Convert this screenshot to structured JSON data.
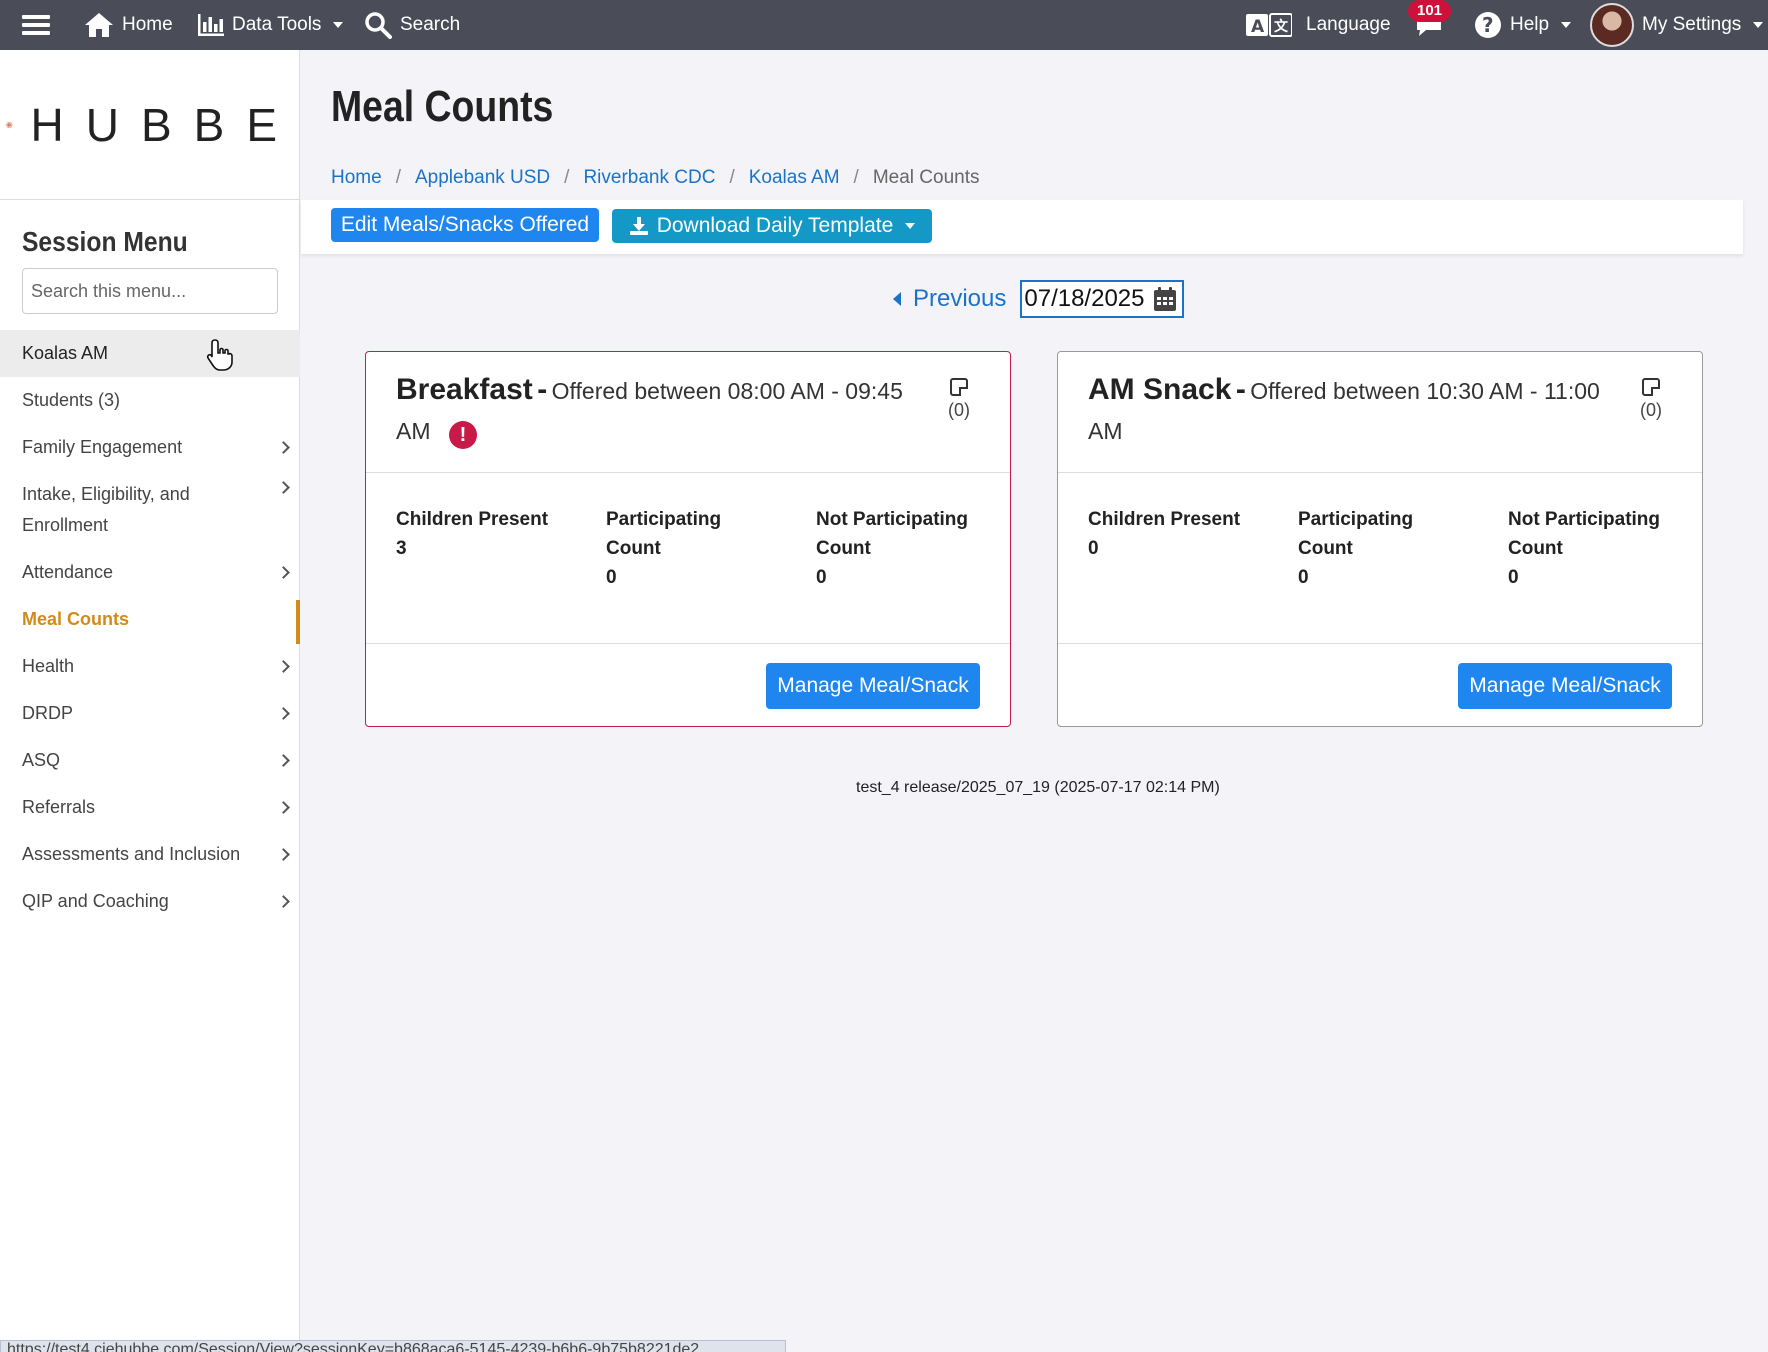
{
  "topbar": {
    "home": "Home",
    "data_tools": "Data Tools",
    "search": "Search",
    "language": "Language",
    "notifications_count": "101",
    "help": "Help",
    "my_settings": "My Settings"
  },
  "logo": {
    "text": "HUBBE"
  },
  "sidebar": {
    "title": "Session Menu",
    "search_placeholder": "Search this menu...",
    "items": [
      {
        "label": "Koalas AM"
      },
      {
        "label": "Students (3)"
      },
      {
        "label": "Family Engagement"
      },
      {
        "label": "Intake, Eligibility, and Enrollment"
      },
      {
        "label": "Attendance"
      },
      {
        "label": "Meal Counts"
      },
      {
        "label": "Health"
      },
      {
        "label": "DRDP"
      },
      {
        "label": "ASQ"
      },
      {
        "label": "Referrals"
      },
      {
        "label": "Assessments and Inclusion"
      },
      {
        "label": "QIP and Coaching"
      }
    ]
  },
  "page": {
    "title": "Meal Counts",
    "breadcrumb": [
      "Home",
      "Applebank USD",
      "Riverbank CDC",
      "Koalas AM",
      "Meal Counts"
    ]
  },
  "toolbar": {
    "edit_label": "Edit Meals/Snacks Offered",
    "download_label": "Download Daily Template"
  },
  "date_nav": {
    "previous_label": "Previous",
    "date_value": "07/18/2025"
  },
  "cards": [
    {
      "name": "Breakfast",
      "dash": "-",
      "offered": "Offered between 08:00 AM - 09:45 AM",
      "notes": "(0)",
      "children_present_label": "Children Present",
      "children_present": "3",
      "participating_label": "Participating Count",
      "participating": "0",
      "not_participating_label": "Not Participating Count",
      "not_participating": "0",
      "button": "Manage Meal/Snack",
      "alert": "!"
    },
    {
      "name": "AM Snack",
      "dash": "-",
      "offered": "Offered between 10:30 AM - 11:00 AM",
      "notes": "(0)",
      "children_present_label": "Children Present",
      "children_present": "0",
      "participating_label": "Participating Count",
      "participating": "0",
      "not_participating_label": "Not Participating Count",
      "not_participating": "0",
      "button": "Manage Meal/Snack"
    }
  ],
  "release": "test_4 release/2025_07_19 (2025-07-17 02:14 PM)",
  "status_url": "https://test4.ciehubbe.com/Session/View?sessionKey=b868aca6-5145-4239-b6b6-9b75b8221de2",
  "colors": {
    "topbar": "#4a4d58",
    "primary": "#1f86f0",
    "teal": "#1499c6",
    "active_menu": "#d28b1a",
    "alert": "#c81a48"
  }
}
